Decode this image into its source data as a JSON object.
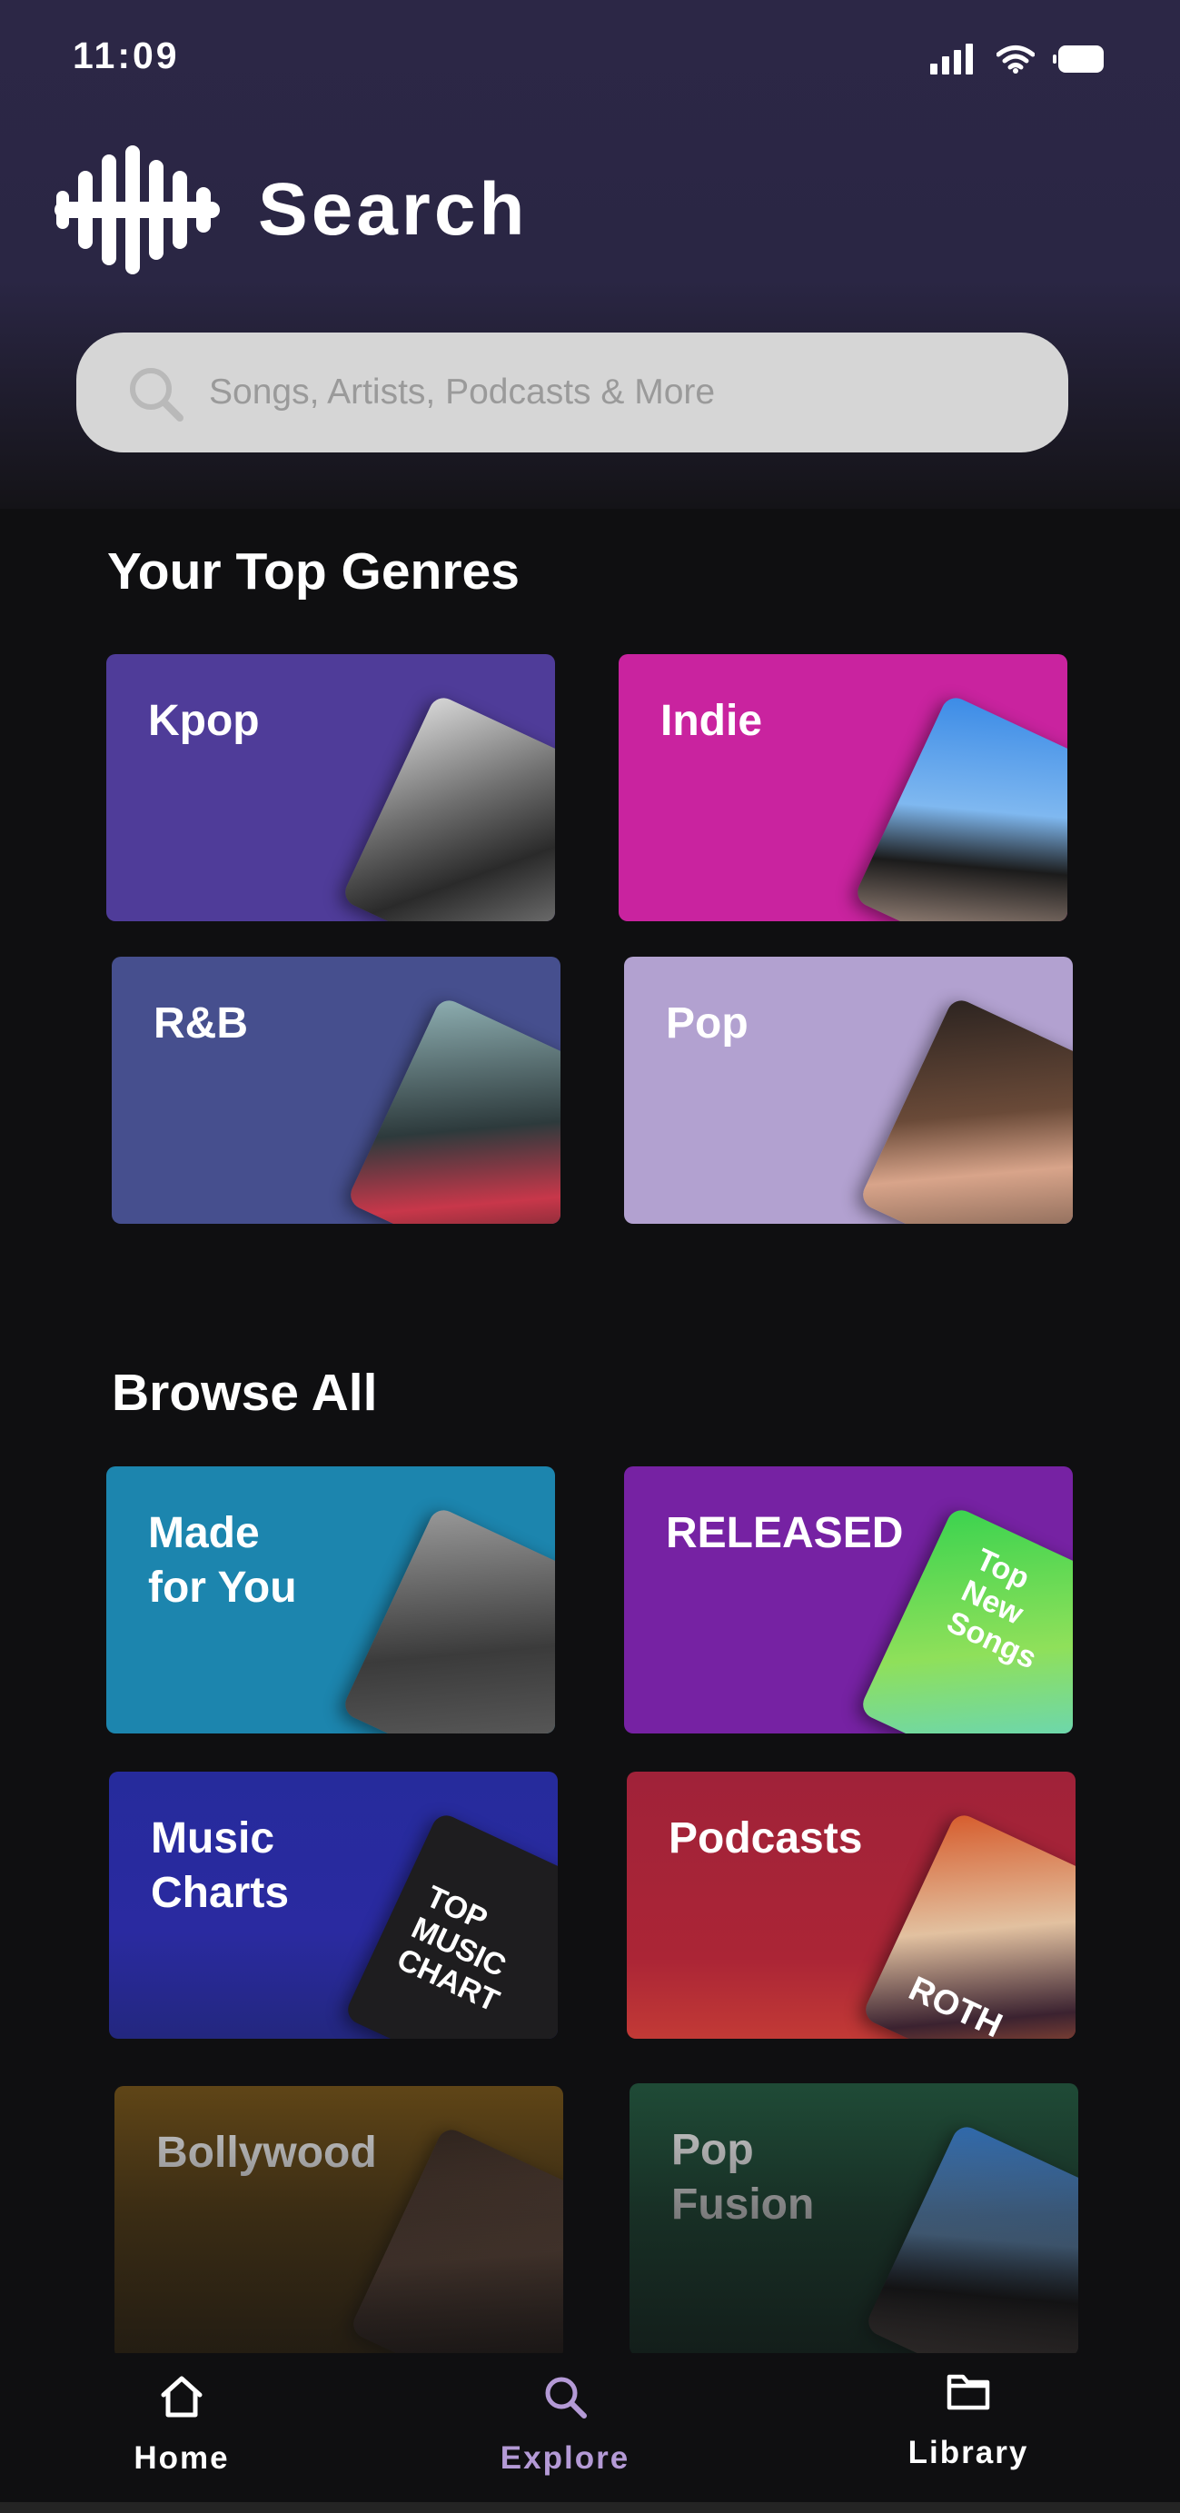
{
  "status_bar": {
    "time": "11:09"
  },
  "header": {
    "title": "Search",
    "logo_icon": "soundwave-logo-icon"
  },
  "search": {
    "placeholder": "Songs, Artists, Podcasts & More",
    "icon": "search-icon"
  },
  "top_genres": {
    "title": "Your Top Genres",
    "cards": [
      {
        "label": "Kpop",
        "color": "#4f3c99"
      },
      {
        "label": "Indie",
        "color": "#c9239f"
      },
      {
        "label": "R&B",
        "color": "#464f8e"
      },
      {
        "label": "Pop",
        "color": "#b2a1d0"
      }
    ]
  },
  "browse_all": {
    "title": "Browse All",
    "cards": [
      {
        "label": "Made\nfor You",
        "color": "#1c85ae"
      },
      {
        "label": "RELEASED",
        "color": "#7622a3",
        "art_text": "Top\nNew Songs"
      },
      {
        "label": "Music\nCharts",
        "color": "#262b9c",
        "art_text": "TOP\nMUSIC\nCHART"
      },
      {
        "label": "Podcasts",
        "color": "#a02239",
        "art_text": "ROTH"
      },
      {
        "label": "Bollywood",
        "color": "#6e4f18"
      },
      {
        "label": "Pop\nFusion",
        "color": "#22553d"
      }
    ]
  },
  "bottom_nav": {
    "active": "Explore",
    "active_color": "#b49ad6",
    "items": [
      {
        "label": "Home",
        "icon": "home-icon"
      },
      {
        "label": "Explore",
        "icon": "search-icon"
      },
      {
        "label": "Library",
        "icon": "folder-icon"
      }
    ]
  }
}
